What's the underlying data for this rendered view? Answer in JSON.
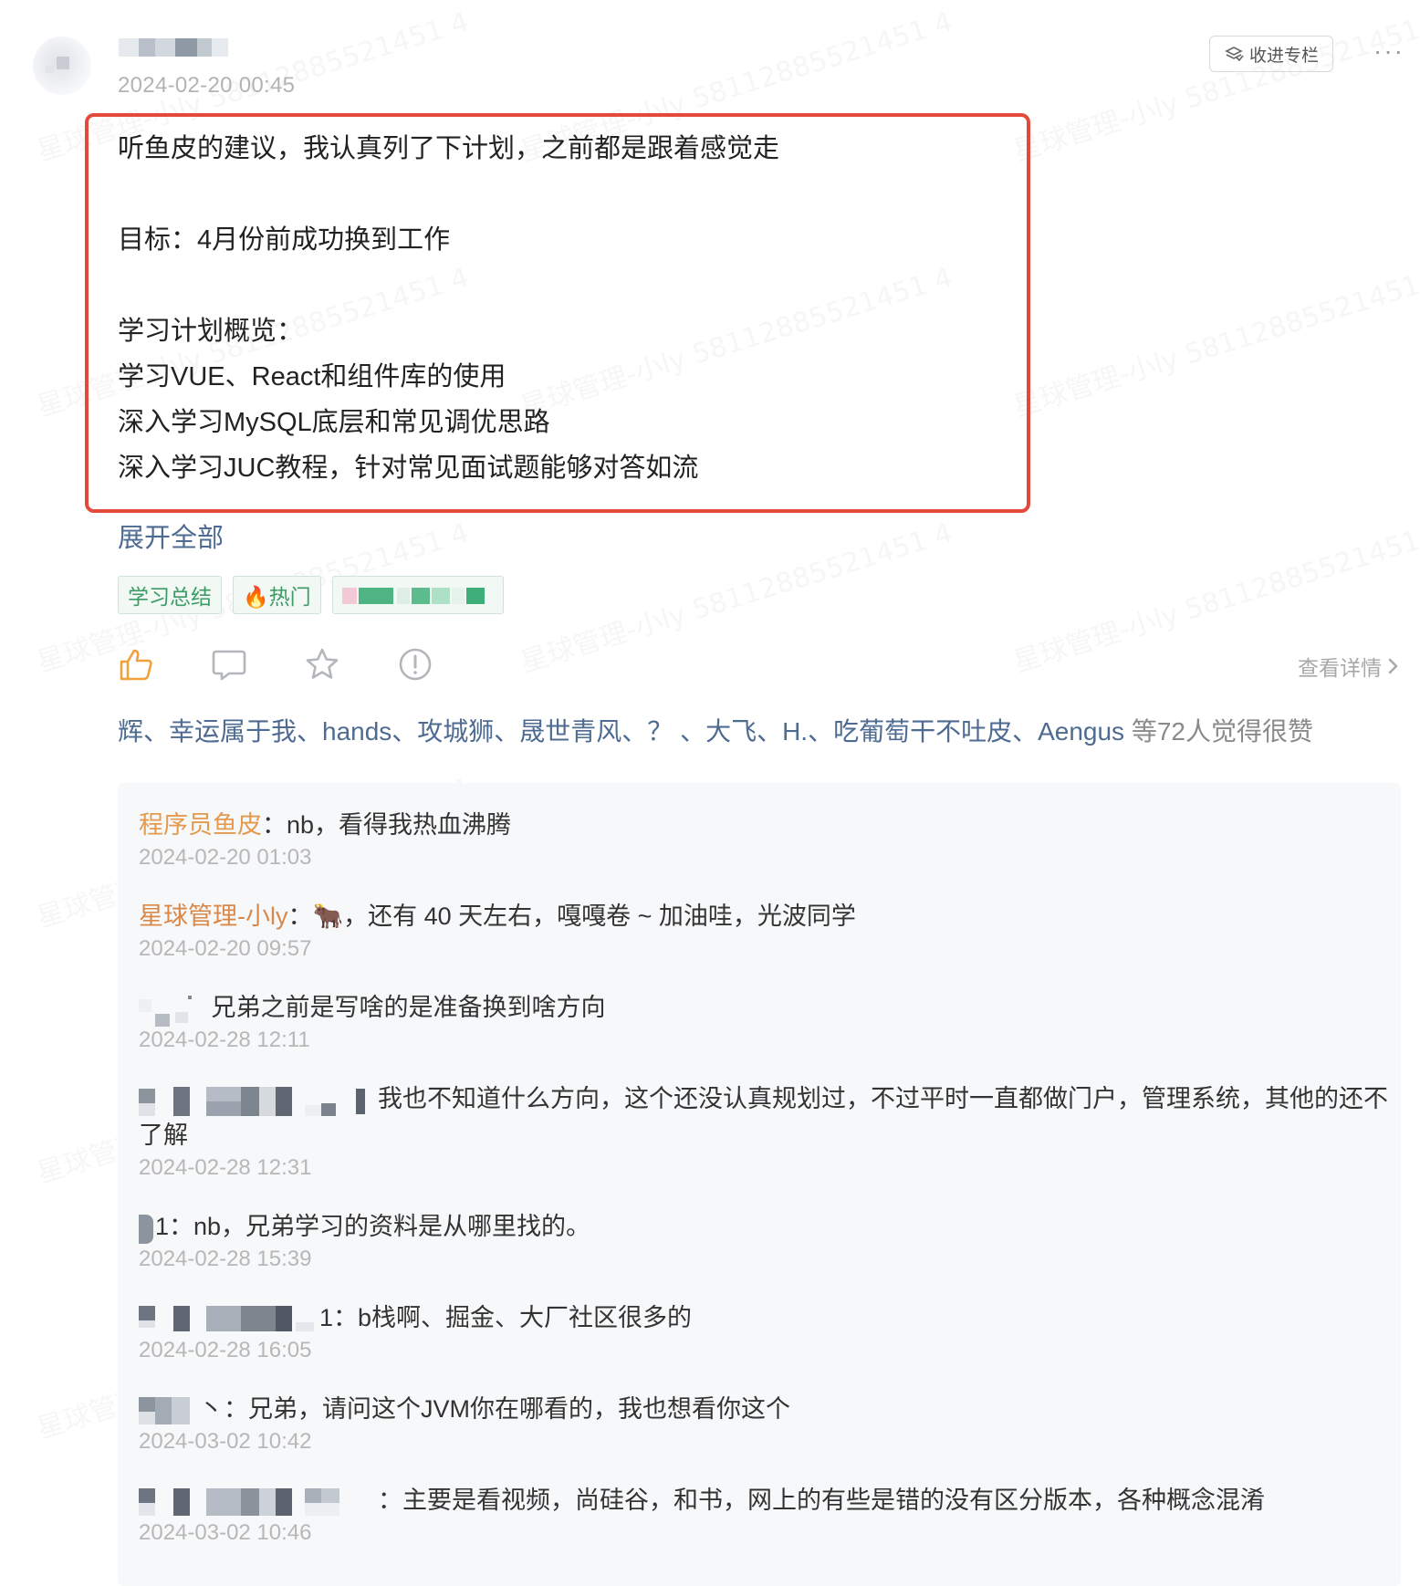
{
  "watermark": "星球管理-小ly 58112885521451 4",
  "post": {
    "time": "2024-02-20 00:45",
    "collect_label": "收进专栏",
    "more_label": "···",
    "content_lines": [
      "听鱼皮的建议，我认真列了下计划，之前都是跟着感觉走",
      "",
      "目标：4月份前成功换到工作",
      "",
      "学习计划概览：",
      "学习VUE、React和组件库的使用",
      "深入学习MySQL底层和常见调优思路",
      "深入学习JUC教程，针对常见面试题能够对答如流"
    ],
    "expand_label": "展开全部",
    "tags": [
      "学习总结",
      "🔥热门"
    ],
    "view_detail_label": "查看详情",
    "likes_names": "辉、幸运属于我、hands、攻城狮、晟世青风、？ 、大飞、H.、吃葡萄干不吐皮、Aengus",
    "likes_suffix": " 等72人觉得很赞"
  },
  "comments": [
    {
      "author": "程序员鱼皮",
      "text": "：nb，看得我热血沸腾",
      "time": "2024-02-20 01:03"
    },
    {
      "author": "星球管理-小ly",
      "text": "：🐂，还有 40 天左右，嘎嘎卷 ~ 加油哇，光波同学",
      "time": "2024-02-20 09:57"
    },
    {
      "author": "",
      "text": "兄弟之前是写啥的是准备换到啥方向",
      "time": "2024-02-28 12:11"
    },
    {
      "author": "",
      "text": "我也不知道什么方向，这个还没认真规划过，不过平时一直都做门户，管理系统，其他的还不了解",
      "time": "2024-02-28 12:31"
    },
    {
      "author": "",
      "text": "1：nb，兄弟学习的资料是从哪里找的。",
      "time": "2024-02-28 15:39"
    },
    {
      "author": "",
      "text": "1：b栈啊、掘金、大厂社区很多的",
      "time": "2024-02-28 16:05"
    },
    {
      "author": "",
      "text": "丶：兄弟，请问这个JVM你在哪看的，我也想看你这个",
      "time": "2024-03-02 10:42"
    },
    {
      "author": "",
      "text": "：主要是看视频，尚硅谷，和书，网上的有些是错的没有区分版本，各种概念混淆",
      "time": "2024-03-02 10:46"
    }
  ]
}
